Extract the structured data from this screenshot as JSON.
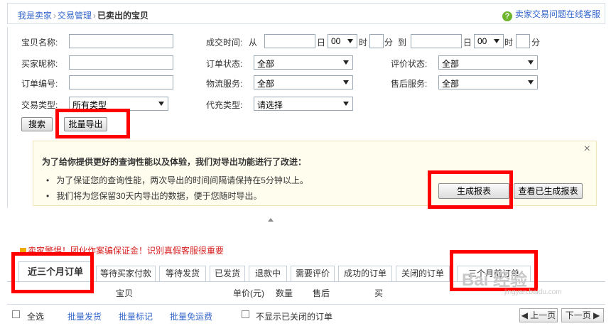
{
  "breadcrumb": {
    "item1": "我是卖家",
    "item2": "交易管理",
    "current": "已卖出的宝贝"
  },
  "help": {
    "label": "卖家交易问题在线客服"
  },
  "form": {
    "item_name_label": "宝贝名称:",
    "deal_time_label": "成交时间:",
    "from": "从",
    "day": "日",
    "hour_value": "00",
    "hour_unit": "时",
    "minute_unit": "分",
    "to": "到",
    "buyer_label": "买家昵称:",
    "order_status_label": "订单状态:",
    "order_status_value": "全部",
    "review_status_label": "评价状态:",
    "review_status_value": "全部",
    "order_no_label": "订单编号:",
    "logistics_label": "物流服务:",
    "logistics_value": "全部",
    "aftersale_label": "售后服务:",
    "aftersale_value": "全部",
    "trade_type_label": "交易类型:",
    "trade_type_value": "所有类型",
    "recharge_type_label": "代充类型:",
    "recharge_type_value": "请选择",
    "search_button": "搜索",
    "export_button": "批量导出"
  },
  "notice": {
    "title": "为了给你提供更好的查询性能以及体验，我们对导出功能进行了改进：",
    "items": [
      "为了保证您的查询性能，两次导出的时间间隔请保持在5分钟以上。",
      "我们将为您保留30天内导出的数据，便于您随时导出。"
    ],
    "generate_button": "生成报表",
    "view_button": "查看已生成报表",
    "close": "×"
  },
  "warning": {
    "prefix": "卖家警惕",
    "text": "！团伙作案骗保证金！识别真假客服很重要"
  },
  "tabs": [
    "近三个月订单",
    "等待买家付款",
    "等待发货",
    "已发货",
    "退款中",
    "需要评价",
    "成功的订单",
    "关闭的订单",
    "三个月前订单"
  ],
  "table_header": {
    "item": "宝贝",
    "price": "单价(元)",
    "qty": "数量",
    "aftersale": "售后",
    "trade": "买"
  },
  "bottom": {
    "select_all": "全选",
    "batch_ship": "批量发货",
    "batch_mark": "批量标记",
    "batch_free_ship": "批量免运费",
    "hide_closed": "不显示已关闭的订单",
    "prev": "◀ 上一页",
    "next": "下一页 ▶"
  },
  "watermark": {
    "logo": "Bai 经验",
    "url": "jingyan.baidu.com"
  }
}
